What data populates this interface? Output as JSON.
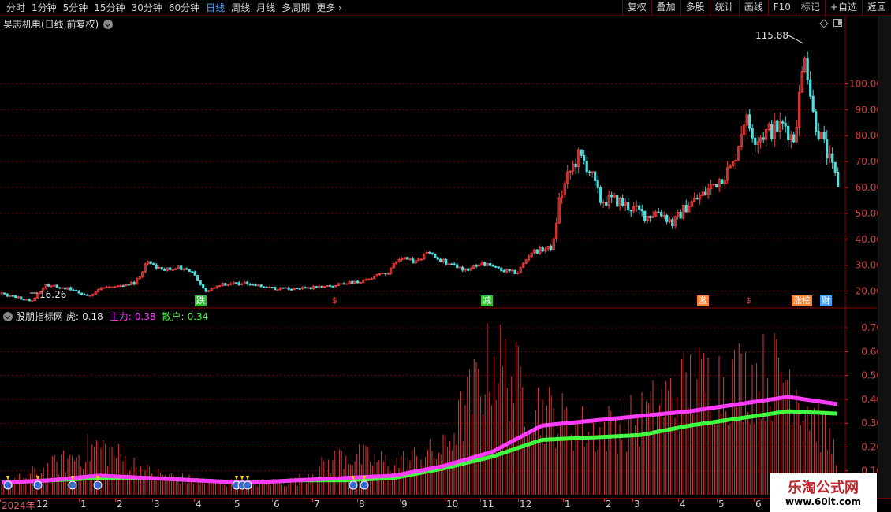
{
  "toolbar": {
    "periods": [
      "分时",
      "1分钟",
      "5分钟",
      "15分钟",
      "30分钟",
      "60分钟",
      "日线",
      "周线",
      "月线",
      "多周期",
      "更多 ›"
    ],
    "active_period": "日线",
    "tools": [
      "复权",
      "叠加",
      "多股",
      "统计",
      "画线",
      "F10",
      "标记",
      "+自选",
      "返回"
    ]
  },
  "stock": {
    "title": "昊志机电(日线,前复权)",
    "max_label": "115.88",
    "min_label": "16.26"
  },
  "indicator": {
    "name": "股朋指标网",
    "tiger_label": "虎:",
    "tiger_value": "0.18",
    "main_label": "主力:",
    "main_value": "0.38",
    "retail_label": "散户:",
    "retail_value": "0.34"
  },
  "colors": {
    "up": "#ff4040",
    "down": "#4fe0e0",
    "main_line": "#ff3cff",
    "retail_line": "#40ff40",
    "grid": "#7a0000",
    "axis_text": "#d04040"
  },
  "event_tags": [
    {
      "text": "跌",
      "color": "#30c030"
    },
    {
      "text": "$",
      "color": "#ff3030"
    },
    {
      "text": "减",
      "color": "#30c030"
    },
    {
      "text": "激",
      "color": "#ff8030"
    },
    {
      "text": "$",
      "color": "#ff3030"
    },
    {
      "text": "涨榜",
      "color": "#ff8030"
    },
    {
      "text": "财",
      "color": "#40a0ff"
    }
  ],
  "axis_months": [
    "2024年",
    "12",
    "1",
    "2",
    "3",
    "4",
    "5",
    "6",
    "7",
    "8",
    "9",
    "10",
    "11",
    "12",
    "1",
    "2",
    "3",
    "4",
    "5",
    "6"
  ],
  "chart_data": [
    {
      "type": "candlestick",
      "title": "昊志机电(日线,前复权)",
      "y_ticks": [
        20,
        30,
        40,
        50,
        60,
        70,
        80,
        90,
        100
      ],
      "ylim": [
        15,
        122
      ],
      "annotations": {
        "max": 115.88,
        "min": 16.26
      },
      "price_path": [
        {
          "t": 0,
          "p": 19
        },
        {
          "t": 20,
          "p": 17.5
        },
        {
          "t": 40,
          "p": 16.5
        },
        {
          "t": 55,
          "p": 22
        },
        {
          "t": 80,
          "p": 21.5
        },
        {
          "t": 110,
          "p": 18
        },
        {
          "t": 130,
          "p": 21.5
        },
        {
          "t": 150,
          "p": 22
        },
        {
          "t": 170,
          "p": 23
        },
        {
          "t": 185,
          "p": 31
        },
        {
          "t": 205,
          "p": 28
        },
        {
          "t": 225,
          "p": 29
        },
        {
          "t": 245,
          "p": 27
        },
        {
          "t": 258,
          "p": 20
        },
        {
          "t": 280,
          "p": 22.5
        },
        {
          "t": 315,
          "p": 23
        },
        {
          "t": 345,
          "p": 21
        },
        {
          "t": 385,
          "p": 21
        },
        {
          "t": 420,
          "p": 22
        },
        {
          "t": 460,
          "p": 24
        },
        {
          "t": 490,
          "p": 27
        },
        {
          "t": 505,
          "p": 33
        },
        {
          "t": 525,
          "p": 31
        },
        {
          "t": 542,
          "p": 35
        },
        {
          "t": 565,
          "p": 31
        },
        {
          "t": 590,
          "p": 28
        },
        {
          "t": 610,
          "p": 31
        },
        {
          "t": 635,
          "p": 28
        },
        {
          "t": 655,
          "p": 27
        },
        {
          "t": 672,
          "p": 35
        },
        {
          "t": 700,
          "p": 37
        },
        {
          "t": 708,
          "p": 55
        },
        {
          "t": 720,
          "p": 65
        },
        {
          "t": 732,
          "p": 72
        },
        {
          "t": 745,
          "p": 68
        },
        {
          "t": 760,
          "p": 55
        },
        {
          "t": 780,
          "p": 55
        },
        {
          "t": 800,
          "p": 52
        },
        {
          "t": 820,
          "p": 49
        },
        {
          "t": 835,
          "p": 51
        },
        {
          "t": 852,
          "p": 46
        },
        {
          "t": 870,
          "p": 53
        },
        {
          "t": 890,
          "p": 57
        },
        {
          "t": 910,
          "p": 63
        },
        {
          "t": 928,
          "p": 68
        },
        {
          "t": 943,
          "p": 87
        },
        {
          "t": 958,
          "p": 79
        },
        {
          "t": 975,
          "p": 82
        },
        {
          "t": 995,
          "p": 84
        },
        {
          "t": 1005,
          "p": 78
        },
        {
          "t": 1015,
          "p": 100
        },
        {
          "t": 1019,
          "p": 115
        },
        {
          "t": 1030,
          "p": 88
        },
        {
          "t": 1045,
          "p": 75
        },
        {
          "t": 1062,
          "p": 61
        }
      ]
    },
    {
      "type": "bar+line",
      "series": [
        {
          "name": "主力",
          "values": [
            0.05,
            0.06,
            0.08,
            0.07,
            0.06,
            0.05,
            0.06,
            0.07,
            0.08,
            0.12,
            0.18,
            0.29,
            0.31,
            0.33,
            0.35,
            0.38,
            0.41,
            0.38
          ]
        },
        {
          "name": "散户",
          "values": [
            0.05,
            0.06,
            0.07,
            0.07,
            0.06,
            0.05,
            0.06,
            0.06,
            0.07,
            0.11,
            0.16,
            0.23,
            0.24,
            0.25,
            0.29,
            0.32,
            0.35,
            0.34
          ]
        },
        {
          "name": "虎",
          "values": [
            0.04,
            0.12,
            0.22,
            0.1,
            0.06,
            0.05,
            0.06,
            0.18,
            0.14,
            0.2,
            0.62,
            0.38,
            0.28,
            0.34,
            0.5,
            0.52,
            0.55,
            0.18
          ]
        }
      ],
      "y_ticks": [
        0.1,
        0.2,
        0.3,
        0.4,
        0.5,
        0.6,
        0.7
      ],
      "ylim": [
        0,
        0.76
      ]
    }
  ],
  "watermark": {
    "title": "乐淘公式网",
    "url": "www.60lt.com"
  }
}
